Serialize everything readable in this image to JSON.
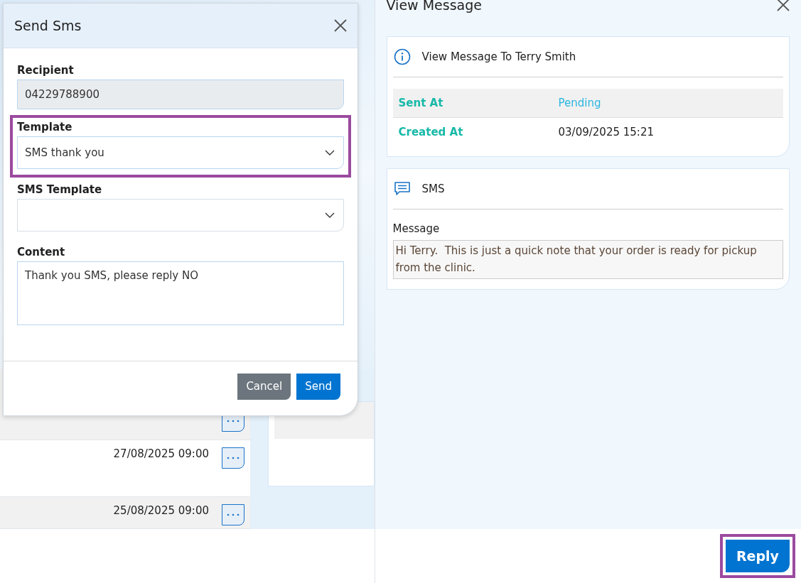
{
  "send_sms_dialog": {
    "title": "Send Sms",
    "fields": [
      {
        "kind": "input",
        "label": "Recipient",
        "value": "04229788900",
        "disabled": true,
        "highlighted": false
      },
      {
        "kind": "select",
        "label": "Template",
        "value": "SMS thank you",
        "highlighted": true
      },
      {
        "kind": "select",
        "label": "SMS Template",
        "highlighted": false
      },
      {
        "kind": "textarea",
        "label": "Content",
        "value": "Thank you SMS, please reply NO",
        "highlighted": false
      }
    ],
    "buttons": [
      {
        "label": "Cancel",
        "kind": "secondary"
      },
      {
        "label": "Send",
        "kind": "primary"
      }
    ]
  },
  "background_list": {
    "rows": [
      {
        "kind": "covered"
      },
      {
        "kind": "dated",
        "date": "27/08/2025 09:00"
      },
      {
        "kind": "dated",
        "date": "25/08/2025 09:00"
      }
    ]
  },
  "view_message": {
    "title": "View Message",
    "info_card": {
      "heading": "View Message To Terry Smith",
      "rows": [
        {
          "label": "Sent At",
          "value": "Pending",
          "kind": "status"
        },
        {
          "label": "Created At",
          "value": "03/09/2025 15:21",
          "kind": "plain"
        }
      ]
    },
    "sms_card": {
      "heading": "SMS",
      "message_label": "Message",
      "message": "Hi Terry.  This is just a quick note that your order is ready for pickup from the clinic."
    },
    "reply_button": {
      "label": "Reply",
      "highlighted": true
    }
  }
}
